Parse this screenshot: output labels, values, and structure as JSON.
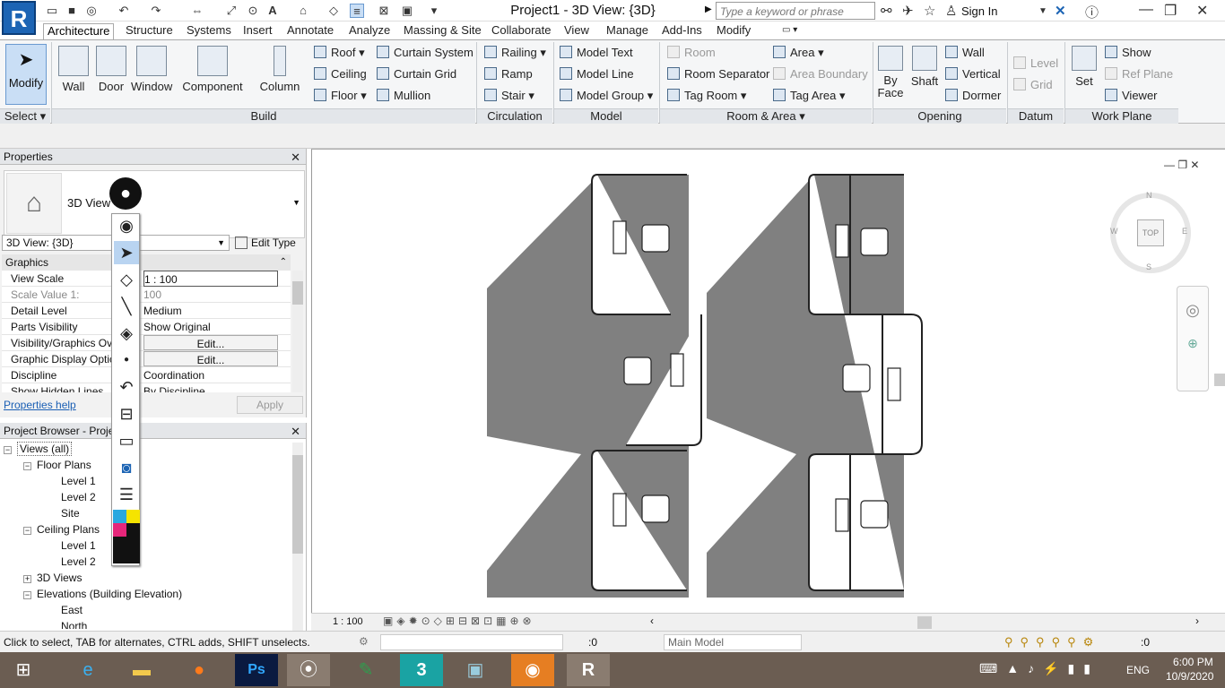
{
  "app": {
    "logo": "R",
    "title": "Project1 - 3D View: {3D}",
    "search_placeholder": "Type a keyword or phrase",
    "sign_in": "Sign In"
  },
  "tabs": [
    "Architecture",
    "Structure",
    "Systems",
    "Insert",
    "Annotate",
    "Analyze",
    "Massing & Site",
    "Collaborate",
    "View",
    "Manage",
    "Add-Ins",
    "Modify"
  ],
  "ribbon": {
    "select": {
      "modify": "Modify",
      "select_panel": "Select ▾"
    },
    "build": {
      "wall": "Wall",
      "door": "Door",
      "window": "Window",
      "component": "Component",
      "column": "Column",
      "roof": "Roof",
      "ceiling": "Ceiling",
      "floor": "Floor",
      "curtain_system": "Curtain System",
      "curtain_grid": "Curtain Grid",
      "mullion": "Mullion",
      "panel": "Build"
    },
    "circulation": {
      "railing": "Railing",
      "ramp": "Ramp",
      "stair": "Stair",
      "panel": "Circulation"
    },
    "model": {
      "model_text": "Model Text",
      "model_line": "Model Line",
      "model_group": "Model Group",
      "panel": "Model"
    },
    "room_area": {
      "room": "Room",
      "room_separator": "Room Separator",
      "tag_room": "Tag Room",
      "area": "Area",
      "area_boundary": "Area Boundary",
      "tag_area": "Tag Area",
      "panel": "Room & Area ▾"
    },
    "opening": {
      "by_face": "By Face",
      "shaft": "Shaft",
      "wall": "Wall",
      "vertical": "Vertical",
      "dormer": "Dormer",
      "panel": "Opening"
    },
    "datum": {
      "level": "Level",
      "grid": "Grid",
      "panel": "Datum"
    },
    "work_plane": {
      "set": "Set",
      "show": "Show",
      "ref_plane": "Ref Plane",
      "viewer": "Viewer",
      "panel": "Work Plane"
    }
  },
  "properties": {
    "title": "Properties",
    "type_name": "3D View",
    "instance": "3D View: {3D}",
    "edit_type": "Edit Type",
    "section": "Graphics",
    "rows": [
      {
        "k": "View Scale",
        "v": "1 : 100"
      },
      {
        "k": "Scale Value    1:",
        "v": "100"
      },
      {
        "k": "Detail Level",
        "v": "Medium"
      },
      {
        "k": "Parts Visibility",
        "v": "Show Original"
      },
      {
        "k": "Visibility/Graphics Ov",
        "v": "Edit..."
      },
      {
        "k": "Graphic Display Optic",
        "v": "Edit..."
      },
      {
        "k": "Discipline",
        "v": "Coordination"
      },
      {
        "k": "Show Hidden Lines",
        "v": "By Discipline"
      }
    ],
    "help": "Properties help",
    "apply": "Apply"
  },
  "browser": {
    "title": "Project Browser - Project1",
    "items": [
      "Views (all)",
      "Floor Plans",
      "Level 1",
      "Level 2",
      "Site",
      "Ceiling Plans",
      "Level 1",
      "Level 2",
      "3D Views",
      "Elevations (Building Elevation)",
      "East",
      "North"
    ]
  },
  "viewcube": {
    "top": "TOP",
    "n": "N",
    "s": "S",
    "e": "E",
    "w": "W"
  },
  "viewctl": {
    "scale": "1 : 100"
  },
  "status": {
    "hint": "Click to select, TAB for alternates, CTRL adds, SHIFT unselects.",
    "zero": ":0",
    "model": "Main Model",
    "filter": ":0"
  },
  "tray": {
    "lang": "ENG",
    "time": "6:00 PM",
    "date": "10/9/2020"
  },
  "colors": {
    "accent": "#1c64b4",
    "shadow": "#808080",
    "taskbar": "#6b5d52"
  }
}
